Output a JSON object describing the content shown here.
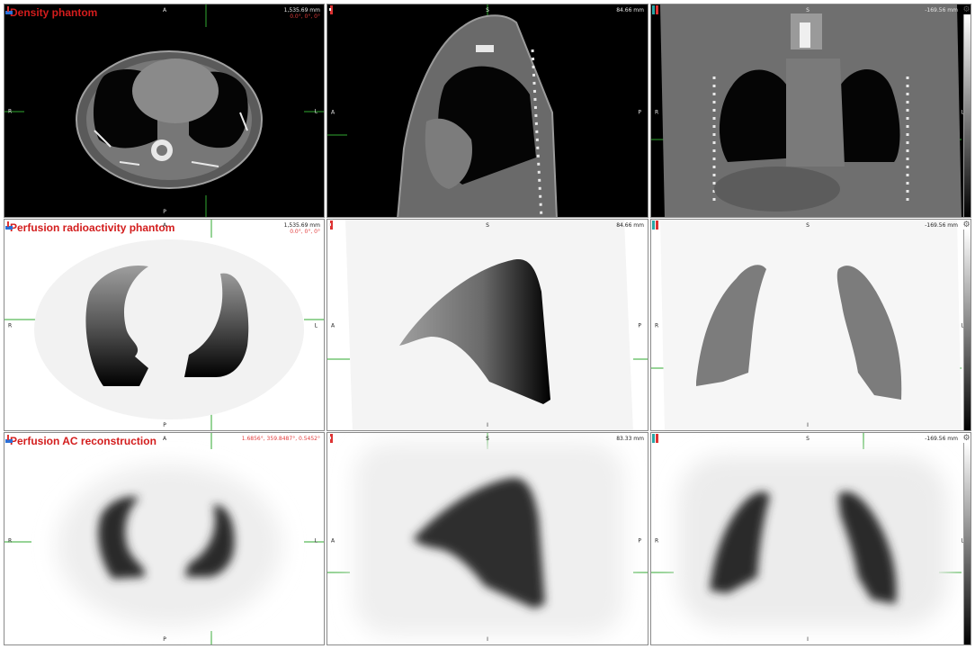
{
  "rows": [
    {
      "title": "Density phantom",
      "axial": {
        "top": "A",
        "bottom": "P",
        "left": "R",
        "right": "L",
        "readout": "1,535.69 mm",
        "angles": "0.0°, 0°, 0°"
      },
      "sagittal": {
        "top": "S",
        "bottom": "",
        "left": "A",
        "right": "P",
        "readout": "84.66 mm"
      },
      "coronal": {
        "top": "S",
        "bottom": "",
        "left": "R",
        "right": "L",
        "readout": "-169.56 mm"
      }
    },
    {
      "title": "Perfusion radioactivity phantom",
      "axial": {
        "top": "A",
        "bottom": "P",
        "left": "R",
        "right": "L",
        "readout": "1,535.69 mm",
        "angles": "0.0°, 0°, 0°"
      },
      "sagittal": {
        "top": "S",
        "bottom": "I",
        "left": "A",
        "right": "P",
        "readout": "84.66 mm"
      },
      "coronal": {
        "top": "S",
        "bottom": "I",
        "left": "R",
        "right": "L",
        "readout": "-169.56 mm"
      }
    },
    {
      "title": "Perfusion AC reconstruction",
      "axial": {
        "top": "A",
        "bottom": "P",
        "left": "R",
        "right": "L",
        "readout": "1.6856°, 359.8487°, 0.5452°"
      },
      "sagittal": {
        "top": "S",
        "bottom": "I",
        "left": "A",
        "right": "P",
        "readout": "83.33 mm"
      },
      "coronal": {
        "top": "S",
        "bottom": "I",
        "left": "R",
        "right": "L",
        "readout": "-169.56 mm"
      }
    }
  ],
  "icons": {
    "settings": "gear-icon",
    "orientation": "body-orientation-icon"
  },
  "colors": {
    "title": "#d31d1d",
    "crosshair": "#2fa82f",
    "tissue": "#7c7c7c",
    "bone": "#f0f0f0"
  }
}
